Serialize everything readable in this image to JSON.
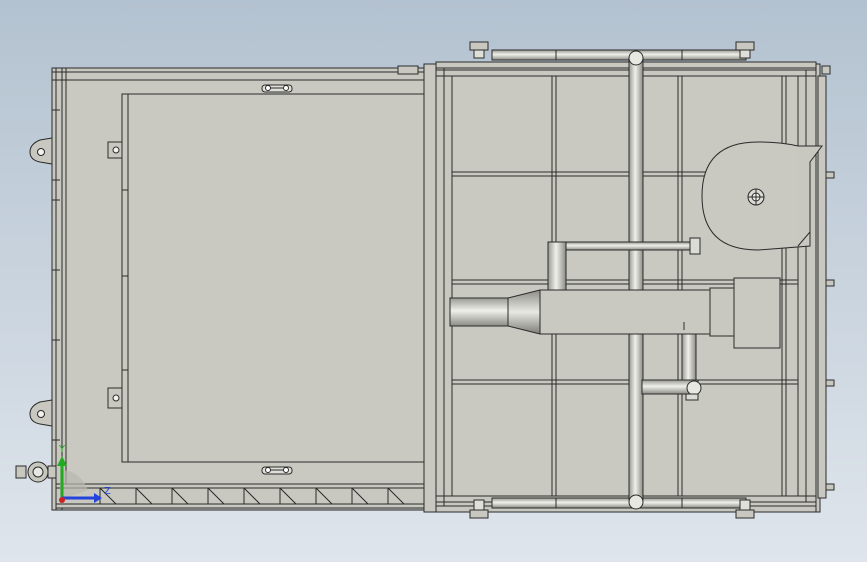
{
  "viewport": {
    "background_top": "#b3c2d0",
    "background_bottom": "#dfe5ec",
    "fill_color": "#c8c8c0",
    "panel_color": "#c9c9c1",
    "edge_color": "#2a2a2a",
    "pipe_color": "#dcdcd6"
  },
  "triad": {
    "x_label": "",
    "y_label": "Y",
    "z_label": "Z",
    "x_color": "#cc2222",
    "y_color": "#22aa22",
    "z_color": "#2244dd"
  }
}
